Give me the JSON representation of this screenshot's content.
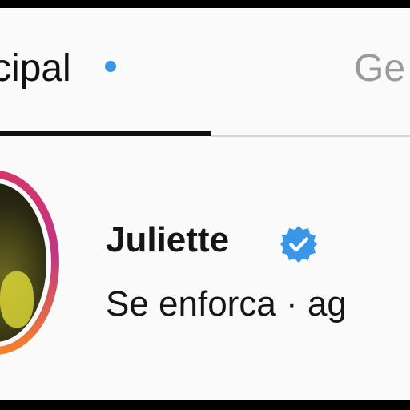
{
  "tabs": [
    {
      "label": "cipal",
      "active": true,
      "has_unread_dot": true
    },
    {
      "label": "Ge",
      "active": false
    }
  ],
  "conversation": {
    "name": "Juliette",
    "verified": true,
    "preview_text": "Se enforca",
    "separator": "·",
    "time": "ag"
  },
  "colors": {
    "background": "#fafafa",
    "text": "#151515",
    "inactive_tab": "#9a9a9a",
    "unread_dot": "#3a97e8",
    "verified_badge": "#3a97e8",
    "story_ring": "#c13584"
  },
  "icons": {
    "verified": "verified-check-icon"
  }
}
